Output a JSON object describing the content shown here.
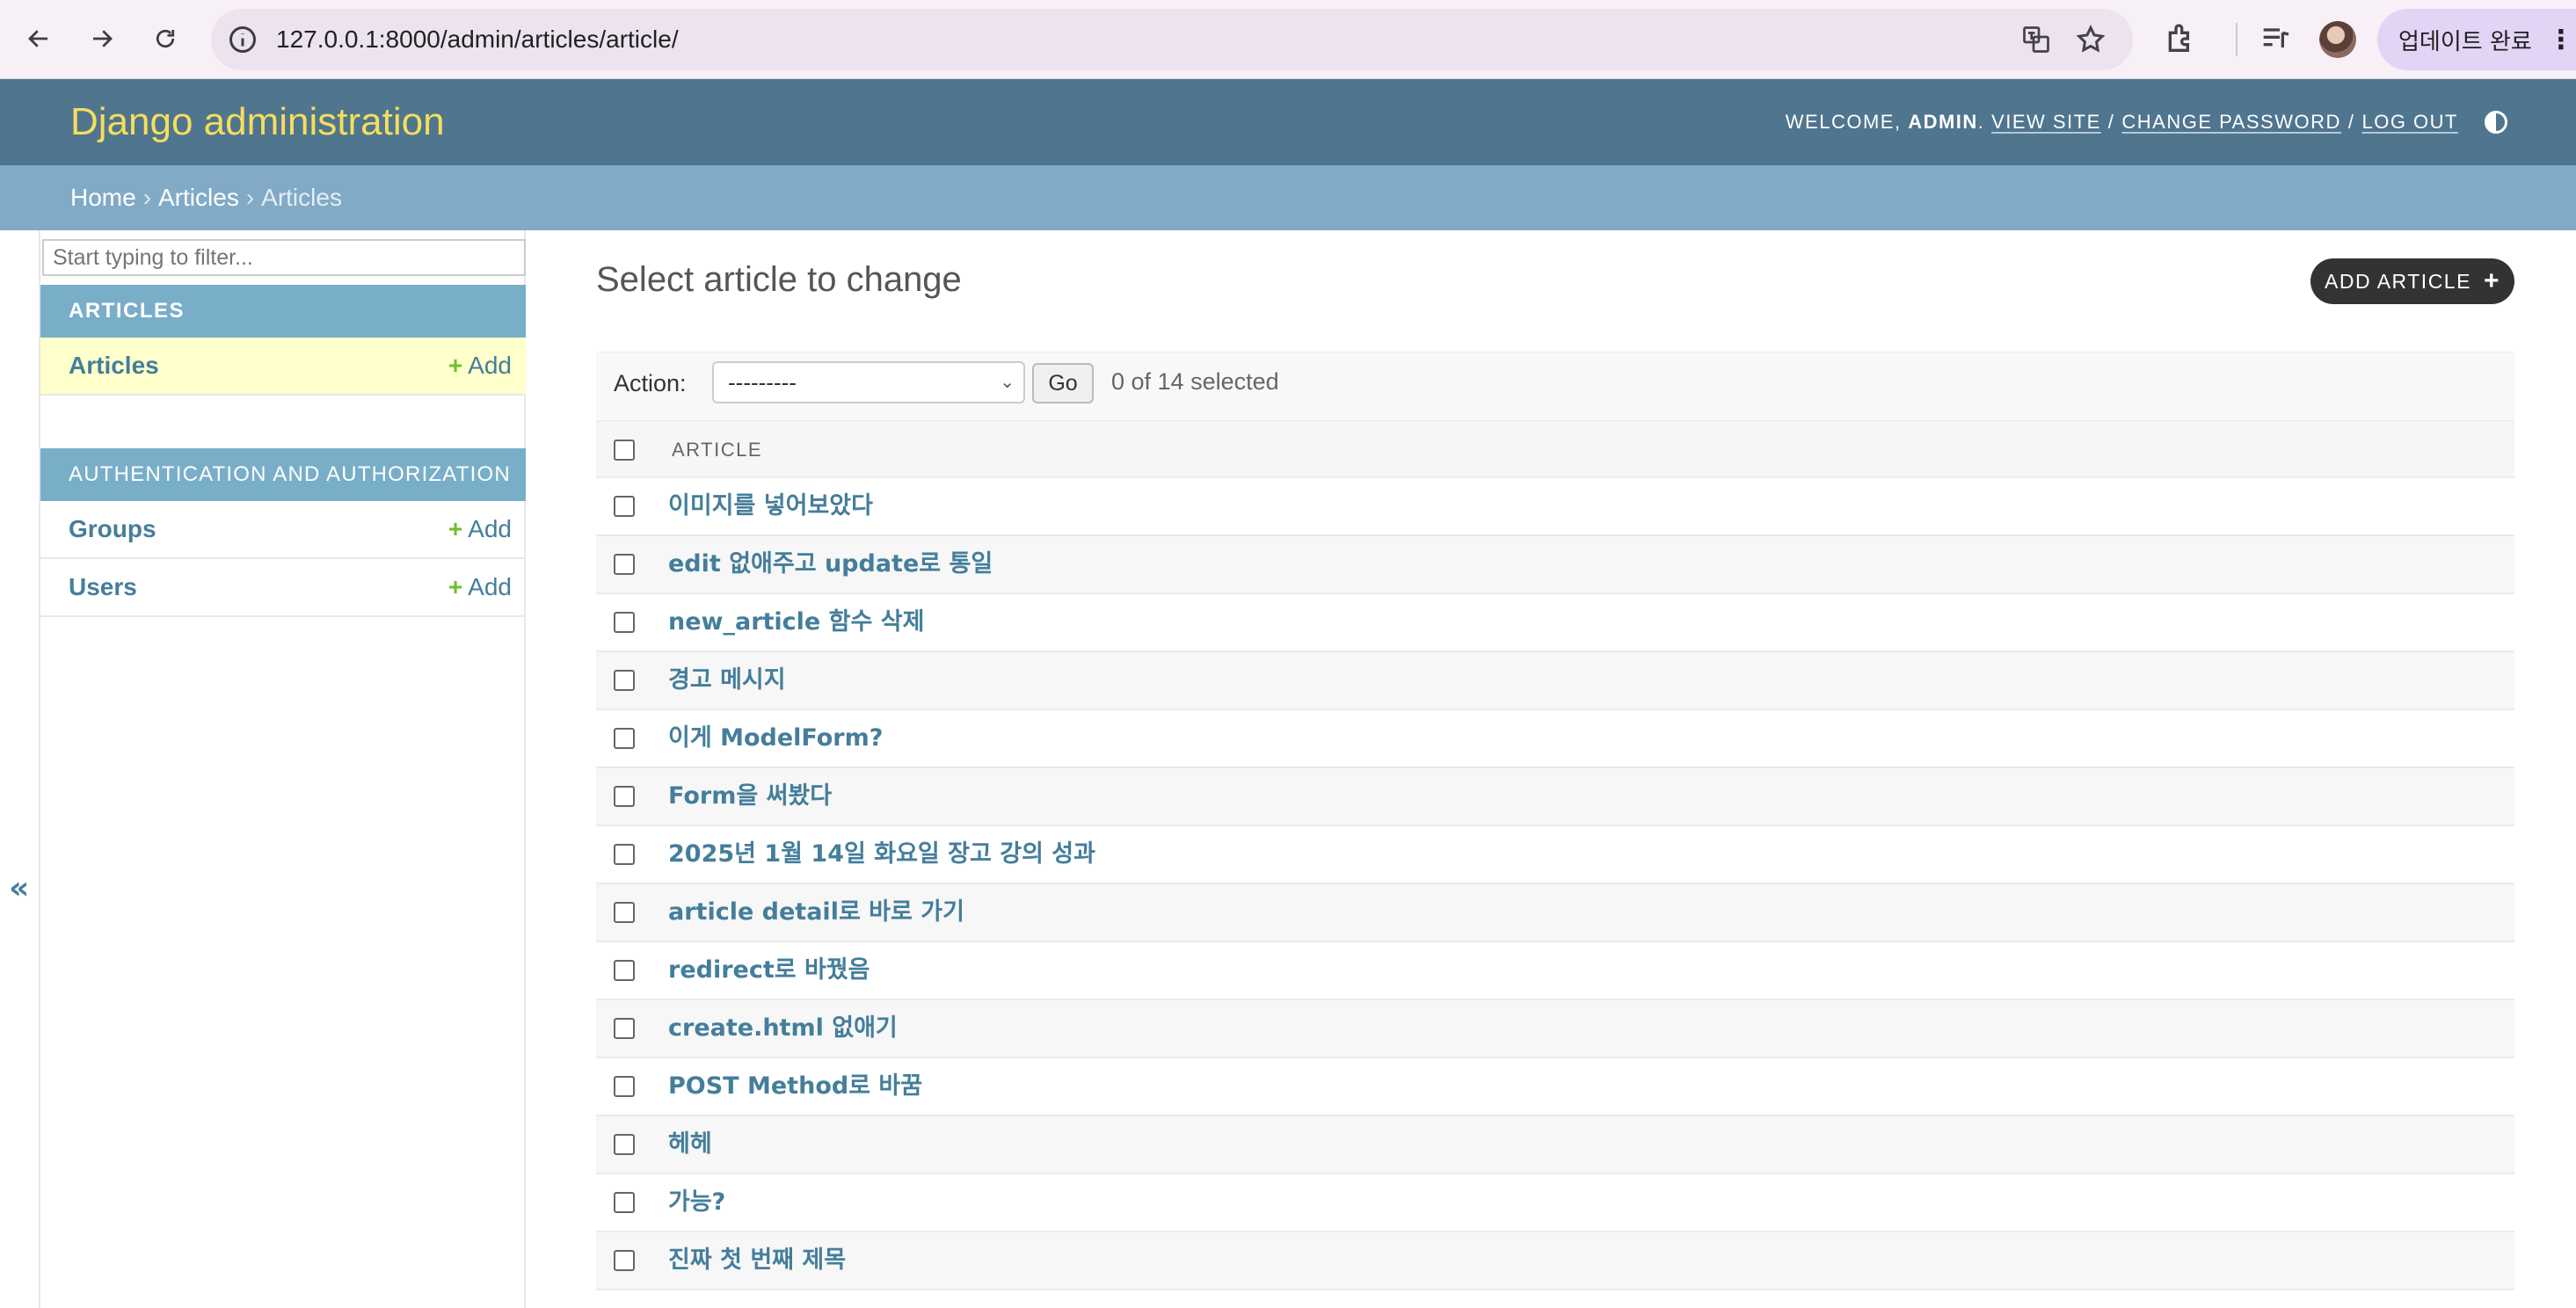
{
  "browser": {
    "url": "127.0.0.1:8000/admin/articles/article/",
    "update_button": "업데이트 완료"
  },
  "header": {
    "branding": "Django administration",
    "welcome": "WELCOME,",
    "username": "ADMIN",
    "view_site": "VIEW SITE",
    "change_password": "CHANGE PASSWORD",
    "log_out": "LOG OUT"
  },
  "breadcrumbs": [
    "Home",
    "Articles",
    "Articles"
  ],
  "sidebar": {
    "filter_placeholder": "Start typing to filter...",
    "modules": [
      {
        "title": "ARTICLES",
        "models": [
          {
            "name": "Articles",
            "add": "Add"
          }
        ]
      },
      {
        "title": "AUTHENTICATION AND AUTHORIZATION",
        "models": [
          {
            "name": "Groups",
            "add": "Add"
          },
          {
            "name": "Users",
            "add": "Add"
          }
        ]
      }
    ],
    "collapse": "«"
  },
  "content": {
    "title": "Select article to change",
    "add_button": "ADD ARTICLE",
    "action_label": "Action:",
    "action_select": "---------",
    "go": "Go",
    "selected_count": "0 of 14 selected",
    "column_header": "ARTICLE",
    "rows": [
      "이미지를 넣어보았다",
      "edit 없애주고 update로 통일",
      "new_article 함수 삭제",
      "경고 메시지",
      "이게 ModelForm?",
      "Form을 써봤다",
      "2025년 1월 14일 화요일 장고 강의 성과",
      "article detail로 바로 가기",
      "redirect로 바꿨음",
      "create.html 없애기",
      "POST Method로 바꿈",
      "헤헤",
      "가능?",
      "진짜 첫 번째 제목"
    ]
  }
}
